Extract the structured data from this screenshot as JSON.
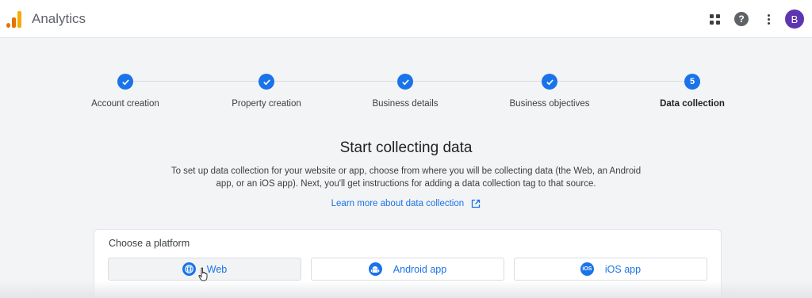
{
  "header": {
    "app_title": "Analytics",
    "avatar_letter": "B"
  },
  "stepper": {
    "steps": [
      {
        "label": "Account creation",
        "state": "done"
      },
      {
        "label": "Property creation",
        "state": "done"
      },
      {
        "label": "Business details",
        "state": "done"
      },
      {
        "label": "Business objectives",
        "state": "done"
      },
      {
        "label": "Data collection",
        "state": "active",
        "number": "5"
      }
    ]
  },
  "main": {
    "heading": "Start collecting data",
    "description": "To set up data collection for your website or app, choose from where you will be collecting data (the Web, an Android app, or an iOS app). Next, you'll get instructions for adding a data collection tag to that source.",
    "learn_more": "Learn more about data collection"
  },
  "platform": {
    "title": "Choose a platform",
    "options": [
      {
        "label": "Web",
        "icon": "globe-icon"
      },
      {
        "label": "Android app",
        "icon": "android-icon"
      },
      {
        "label": "iOS app",
        "icon": "ios-icon",
        "icon_text": "iOS"
      }
    ]
  },
  "colors": {
    "accent": "#1a73e8",
    "avatar": "#5e35b1",
    "logo_orange": "#e37400",
    "logo_yellow": "#f9ab00"
  }
}
